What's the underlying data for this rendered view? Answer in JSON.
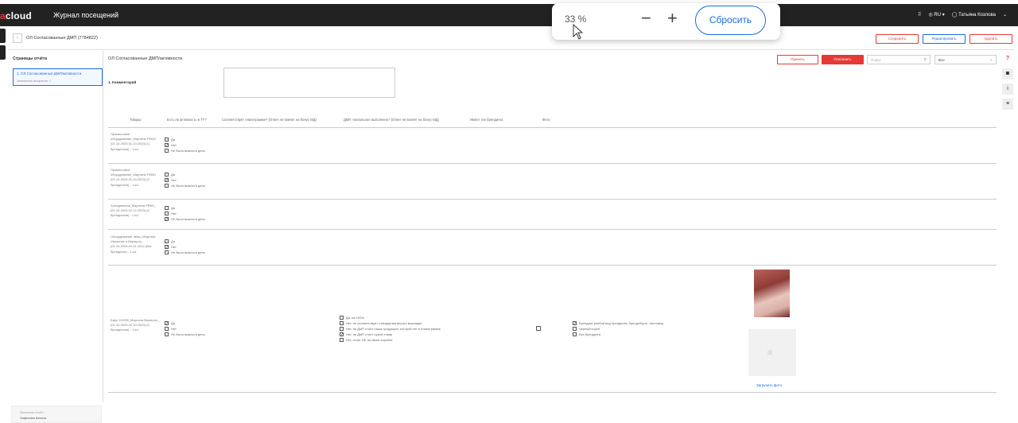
{
  "topbar": {
    "logo_prefix": "a",
    "logo_text": "cloud",
    "app_title": "Журнал посещений",
    "lang": "RU",
    "user": "Татьяна Козлова"
  },
  "zoom": {
    "value": "33 %",
    "minus": "−",
    "plus": "+",
    "reset": "Сбросить"
  },
  "crumb": {
    "back": "‹",
    "title": "ОЛ Согласованные ДМП (7784822)",
    "buttons": {
      "save": "Сохранить",
      "edit": "Редактировать",
      "delete": "Удалить"
    }
  },
  "left_panel": {
    "title": "Страницы отчёта",
    "item_title": "1. ОЛ Согласованные ДМП/активности",
    "item_sub": "Заполнено вопросов: 7",
    "foot_label": "Заполнил отчёт:",
    "foot_name": "Хафизова Кэльна"
  },
  "section": {
    "title": "ОЛ Согласованные ДМП/активности",
    "accept": "Принять",
    "reject": "Отклонить",
    "search_placeholder": "Поиск",
    "filter": "Все",
    "comment_label": "1.   Комментарий"
  },
  "table": {
    "headers": [
      "Товары",
      "Есть ли активность в ТТ?",
      "Соответствует планограмме? (Ответ не влияет на бонус МД)",
      "ДМП «напольное выполнено? (Ответ не влияет на бонус МД)",
      "Имеет тип брендинга",
      "Фото"
    ],
    "rows": [
      {
        "name": "Прикассовое оборудование_Мартини PEBO (01.10.2023-31.10.2023) (С брендингом) - 1 шт",
        "options": [
          "Да",
          "Нет",
          "Не было визита в день"
        ],
        "checked": 1
      },
      {
        "name": "Прикассовое оборудование_Мартини PEBO (01.10.2023-31.10.2023) (С брендингом) - 1 шт",
        "options": [
          "Да",
          "Нет",
          "Не было визита в день"
        ],
        "checked": 1
      },
      {
        "name": "Холодильник_Мартини PEBO_ (01.10.2023-01.12.2023) (С брендингом) - 1 шт",
        "options": [
          "Да",
          "Нет",
          "Не было визита в день"
        ],
        "checked": 2
      },
      {
        "name": "Оборудование липы_Мартини Игристые и Вермуты_ (01.10.2023-01.01.2024 (без брендинга) - 1 шт",
        "options": [
          "Да",
          "Нет",
          "Не было визита в день"
        ],
        "checked": 1
      },
      {
        "name": "Бару 100*80_Мартини Вермуты_ (01.10.2023-31.10.2023) (С брендингом) - 1 шт",
        "options": [
          "Да",
          "Нет",
          "Не было визита в день"
        ],
        "checked": 0
      }
    ],
    "plan_options": [
      "Да, на 100%",
      "Нет, не соответствует стандартам внутри выкладки",
      "Нет, на ДМП стоит наша продукция, которой нет в планограмме",
      "Нет, на ДМП стоит чужой товар",
      "Нет, стоит НЕ на своих коробах"
    ],
    "plan_checked": 3,
    "brand_options": [
      "Брендинг (любой вид брендинга, брендсбортс, пистовка)",
      "Черный короб",
      "Без брендинга"
    ],
    "brand_checked": 0,
    "upload_label": "Загрузить фото"
  }
}
